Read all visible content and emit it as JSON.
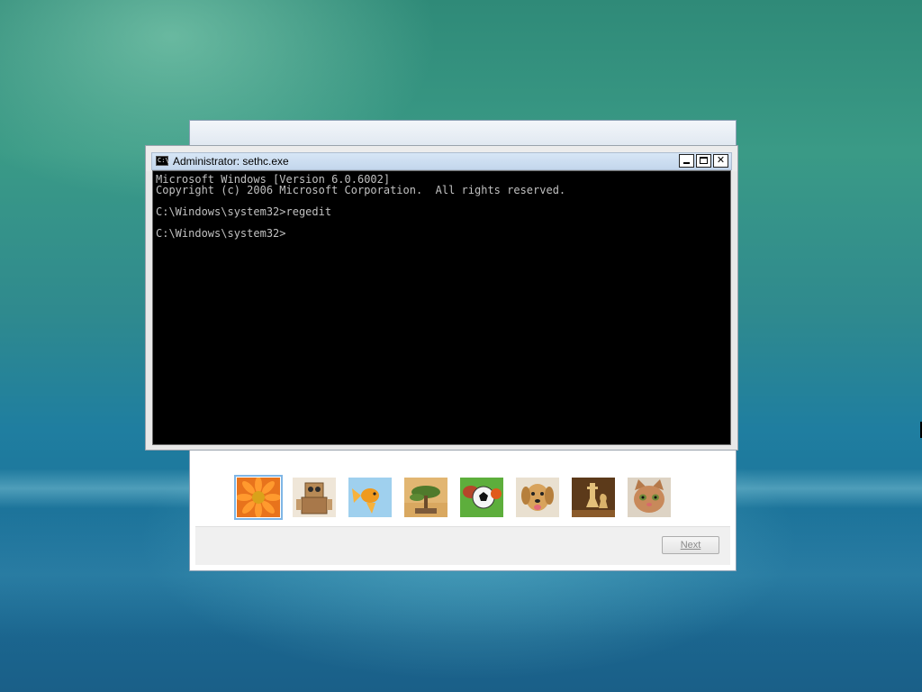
{
  "console": {
    "title": "Administrator: sethc.exe",
    "icon": "C:\\",
    "lines": [
      "Microsoft Windows [Version 6.0.6002]",
      "Copyright (c) 2006 Microsoft Corporation.  All rights reserved.",
      "",
      "C:\\Windows\\system32>regedit",
      "",
      "C:\\Windows\\system32>"
    ],
    "controls": {
      "minimize": "minimize",
      "maximize": "maximize",
      "close": "✕"
    }
  },
  "wizard": {
    "next_label": "Next",
    "pictures": [
      {
        "name": "flower",
        "selected": true
      },
      {
        "name": "robot",
        "selected": false
      },
      {
        "name": "goldfish",
        "selected": false
      },
      {
        "name": "bonsai",
        "selected": false
      },
      {
        "name": "soccer-ball",
        "selected": false
      },
      {
        "name": "dog",
        "selected": false
      },
      {
        "name": "chess",
        "selected": false
      },
      {
        "name": "kitten",
        "selected": false
      }
    ]
  },
  "colors": {
    "console_bg": "#000000",
    "console_text": "#c0c0c0",
    "title_bar": "#c3d6ec"
  }
}
